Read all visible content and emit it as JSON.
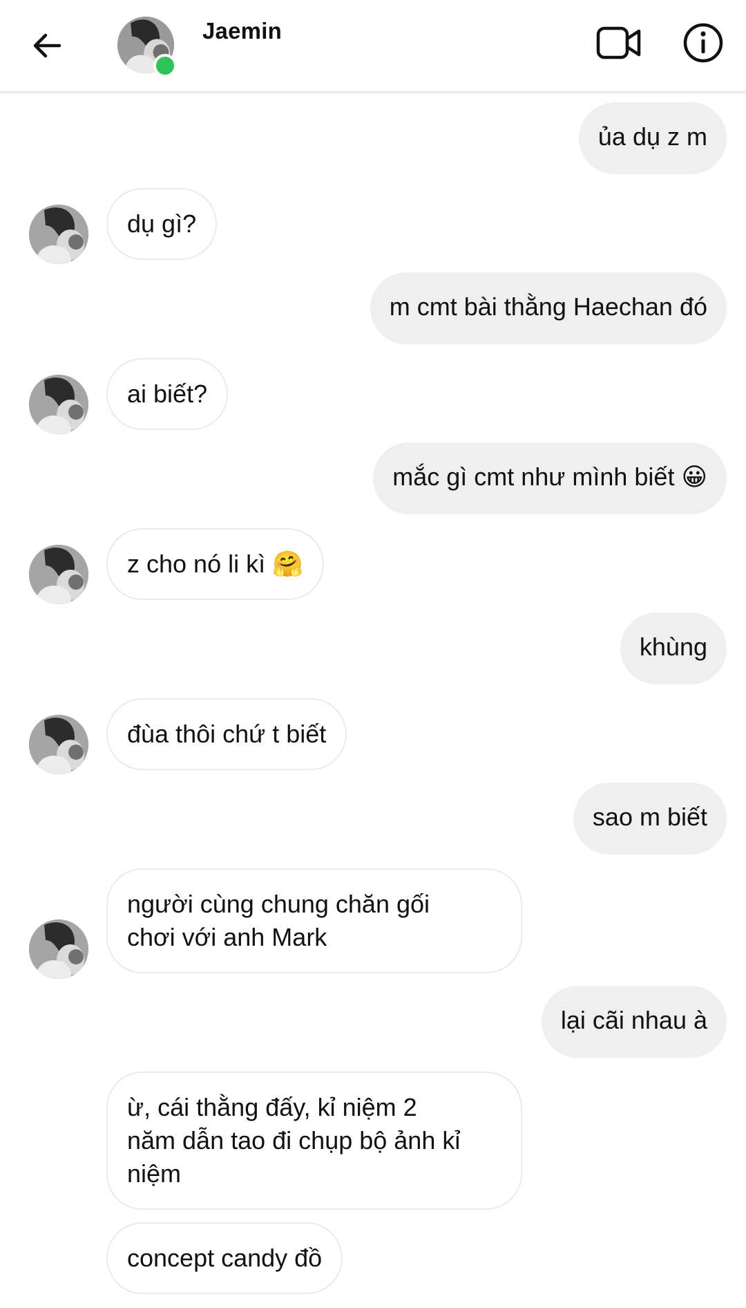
{
  "header": {
    "title": "Jaemin",
    "status": "online"
  },
  "colors": {
    "outgoing_bubble": "#efefef",
    "incoming_bubble_border": "#eaeaea",
    "online_dot": "#2fc35a"
  },
  "icons": {
    "back": "arrow-left-icon",
    "video": "video-camera-icon",
    "info": "info-icon"
  },
  "messages": [
    {
      "side": "out",
      "text": "ủa dụ z m"
    },
    {
      "side": "in",
      "text": "dụ gì?"
    },
    {
      "side": "out",
      "text": "m cmt bài thằng Haechan đó"
    },
    {
      "side": "in",
      "text": "ai biết?"
    },
    {
      "side": "out",
      "text": "mắc gì cmt như mình biết 😀"
    },
    {
      "side": "in",
      "text": "z cho nó li kì 🤗"
    },
    {
      "side": "out",
      "text": "khùng"
    },
    {
      "side": "in",
      "text": "đùa thôi chứ t biết"
    },
    {
      "side": "out",
      "text": "sao m biết"
    },
    {
      "side": "in",
      "text": "người cùng chung chăn gối\nchơi với anh Mark"
    },
    {
      "side": "out",
      "text": "lại cãi nhau à"
    },
    {
      "side": "in",
      "text": "ừ, cái thằng đấy, kỉ niệm 2\nnăm dẫn tao đi chụp bộ ảnh kỉ\nniệm"
    },
    {
      "side": "in",
      "text": "concept candy đồ"
    }
  ]
}
